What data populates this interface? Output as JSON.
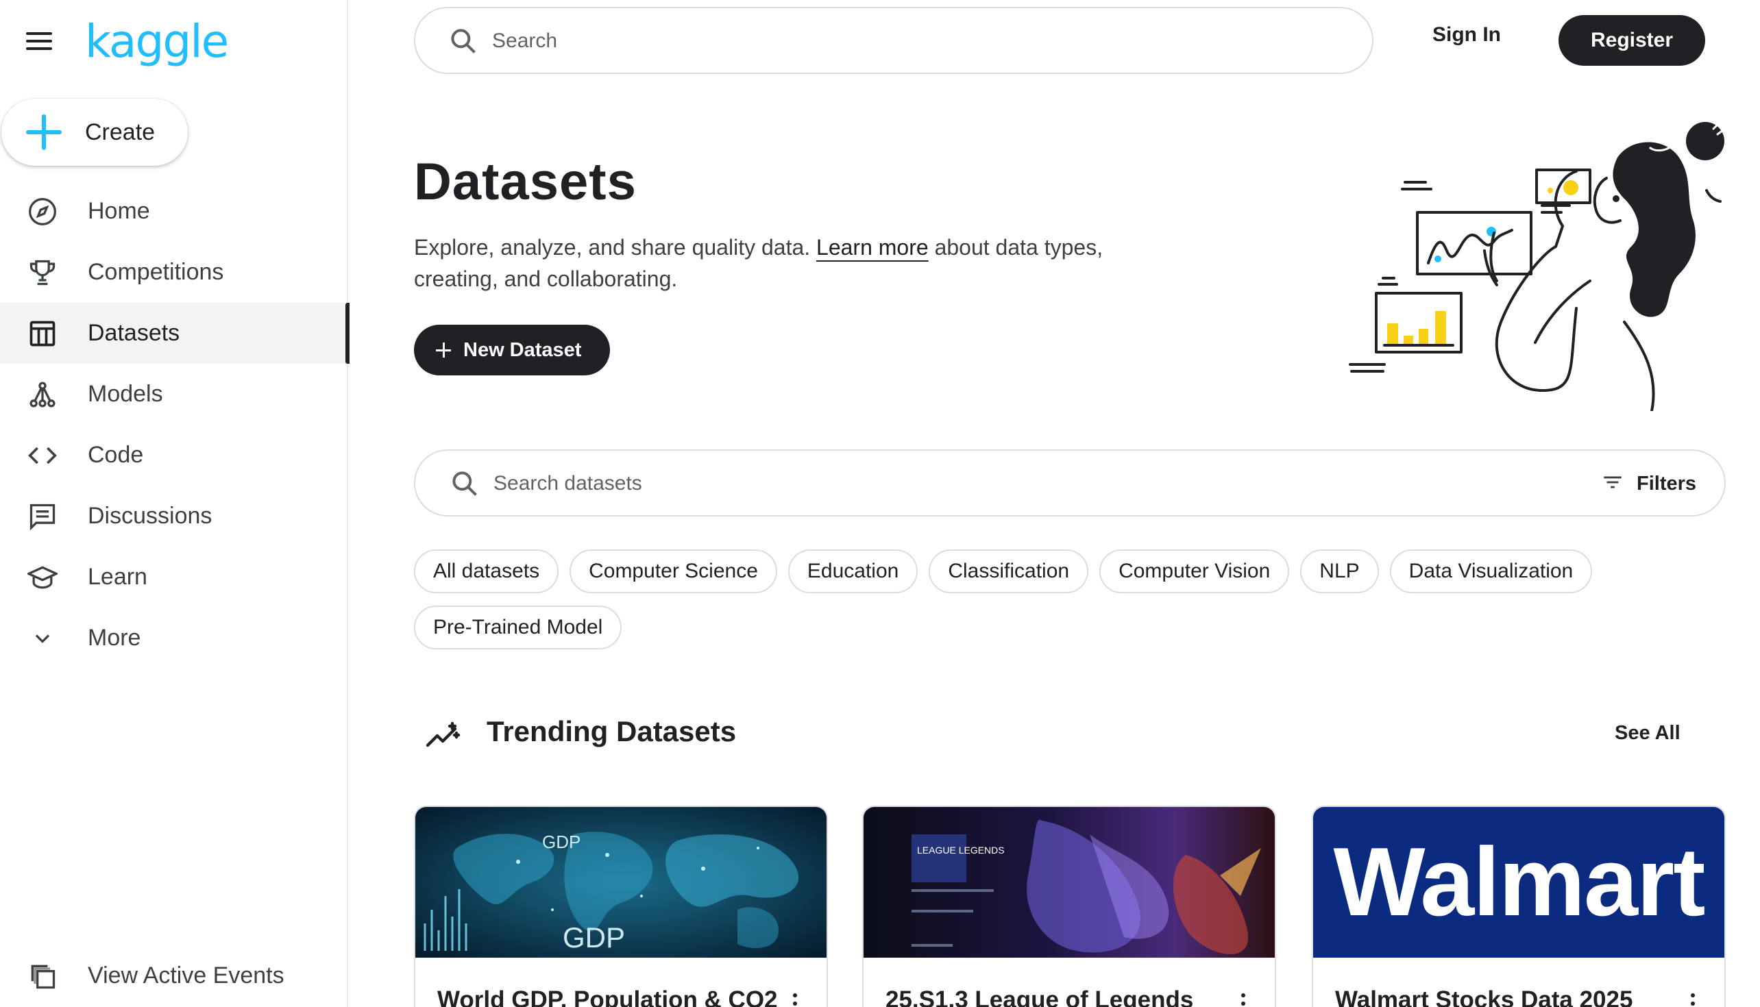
{
  "app": {
    "logo_text": "kaggle",
    "brand_color": "#20beff",
    "dark_color": "#202124"
  },
  "sidebar": {
    "create_label": "Create",
    "items": [
      {
        "label": "Home",
        "icon": "compass-icon"
      },
      {
        "label": "Competitions",
        "icon": "trophy-icon"
      },
      {
        "label": "Datasets",
        "icon": "table-icon",
        "active": true
      },
      {
        "label": "Models",
        "icon": "models-icon"
      },
      {
        "label": "Code",
        "icon": "code-icon"
      },
      {
        "label": "Discussions",
        "icon": "comments-icon"
      },
      {
        "label": "Learn",
        "icon": "graduation-cap-icon"
      },
      {
        "label": "More",
        "icon": "chevron-down-icon"
      }
    ],
    "events_label": "View Active Events"
  },
  "header": {
    "search_placeholder": "Search",
    "sign_in": "Sign In",
    "register": "Register"
  },
  "hero": {
    "title": "Datasets",
    "subtitle_before": "Explore, analyze, and share quality data. ",
    "learn_more": "Learn more",
    "subtitle_after": " about data types, creating, and collaborating.",
    "new_dataset": "New Dataset"
  },
  "dataset_search": {
    "placeholder": "Search datasets",
    "filters": "Filters"
  },
  "chips": [
    "All datasets",
    "Computer Science",
    "Education",
    "Classification",
    "Computer Vision",
    "NLP",
    "Data Visualization",
    "Pre-Trained Model"
  ],
  "trending": {
    "title": "Trending Datasets",
    "see_all": "See All",
    "cards": [
      {
        "title": "World GDP, Population & CO2",
        "thumb_text_1": "GDP",
        "thumb_text_2": "GDP"
      },
      {
        "title": "25.S1.3 League of Legends",
        "thumb_text_1": "LEAGUE LEGENDS"
      },
      {
        "title": "Walmart Stocks Data 2025",
        "thumb_text_1": "Walmart"
      }
    ]
  }
}
